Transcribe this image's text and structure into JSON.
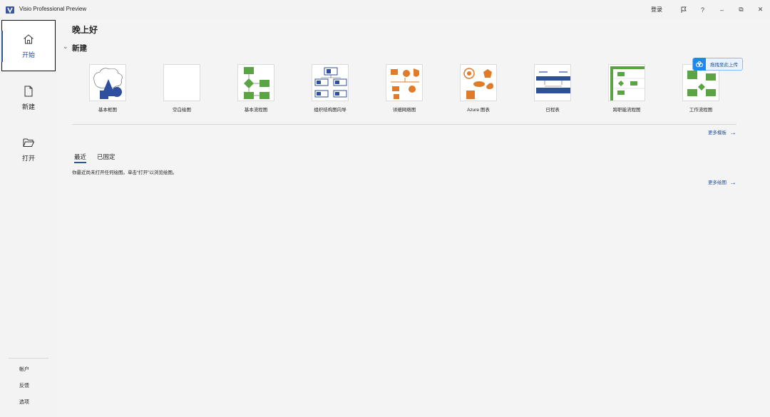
{
  "titlebar": {
    "app_title": "Visio Professional Preview",
    "login_label": "登录",
    "help_label": "?",
    "minimize_label": "–",
    "restore_label": "⧉",
    "close_label": "✕"
  },
  "sidebar": {
    "items": [
      {
        "label": "开始",
        "icon": "home-icon",
        "active": true
      },
      {
        "label": "新建",
        "icon": "new-document-icon",
        "active": false
      },
      {
        "label": "打开",
        "icon": "folder-open-icon",
        "active": false
      }
    ],
    "bottom_links": [
      "帐户",
      "反馈",
      "选项"
    ]
  },
  "main": {
    "greeting": "晚上好",
    "new_section": {
      "title": "新建",
      "templates": [
        {
          "label": "基本框图",
          "icon": "basic-diagram-thumb"
        },
        {
          "label": "空白绘图",
          "icon": "blank-drawing-thumb"
        },
        {
          "label": "基本流程图",
          "icon": "basic-flowchart-thumb"
        },
        {
          "label": "组织结构图向导",
          "icon": "org-chart-thumb"
        },
        {
          "label": "详细网络图",
          "icon": "network-diagram-thumb"
        },
        {
          "label": "Azure 图表",
          "icon": "azure-diagram-thumb"
        },
        {
          "label": "日程表",
          "icon": "timeline-thumb"
        },
        {
          "label": "跨职能流程图",
          "icon": "cross-functional-flowchart-thumb"
        },
        {
          "label": "工作流程图",
          "icon": "workflow-diagram-thumb"
        }
      ],
      "more_templates": "更多模板"
    },
    "tabs": [
      {
        "label": "最近",
        "active": true
      },
      {
        "label": "已固定",
        "active": false
      }
    ],
    "empty_message": "你最近尚未打开任何绘图。单击“打开”以浏览绘图。",
    "more_drawings": "更多绘图",
    "upload_badge": "拖拽至此上传"
  },
  "colors": {
    "accent": "#2b5797",
    "visio_blue": "#2e4e9e",
    "visio_green": "#5ba444",
    "visio_orange": "#e07b2a"
  }
}
